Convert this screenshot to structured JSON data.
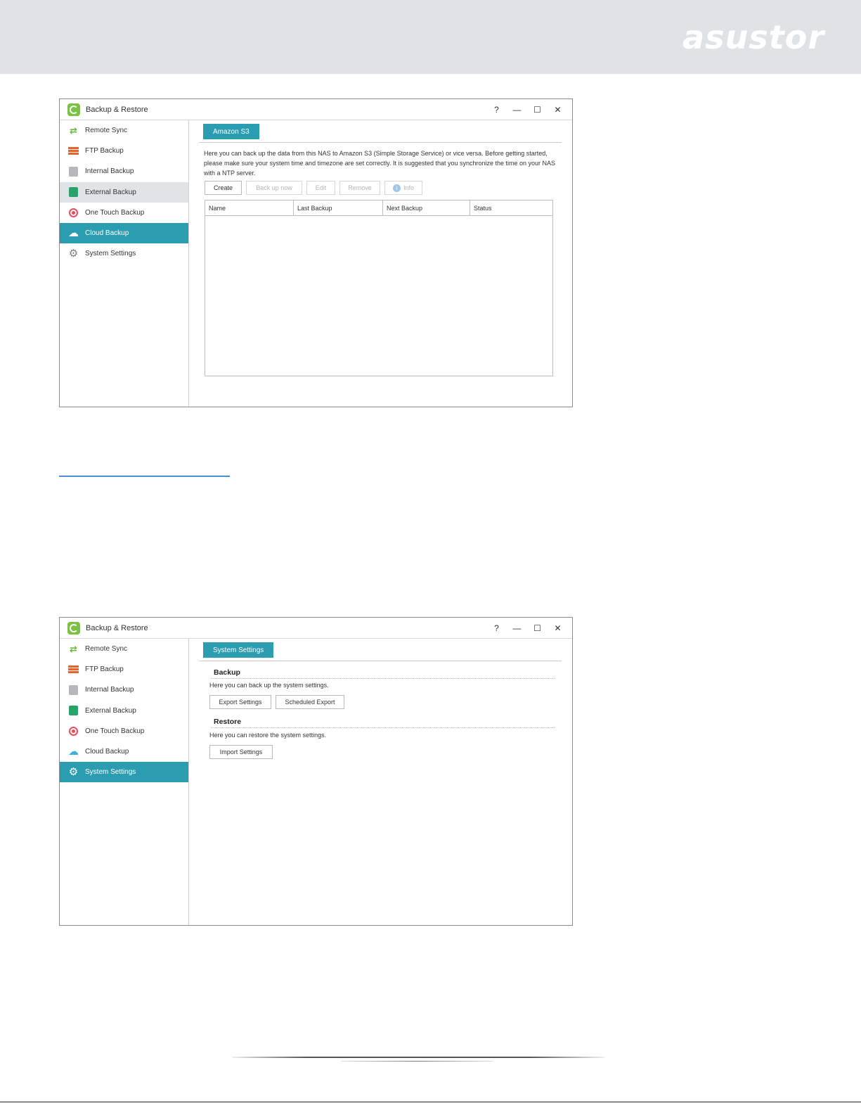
{
  "brand": {
    "logo_text": "asustor"
  },
  "window_top": {
    "title": "Backup & Restore",
    "controls": {
      "help": "?",
      "minimize": "—",
      "maximize": "☐",
      "close": "✕"
    },
    "sidebar": [
      {
        "label": "Remote Sync",
        "icon": "remote-sync-icon",
        "state": "normal"
      },
      {
        "label": "FTP Backup",
        "icon": "ftp-backup-icon",
        "state": "normal"
      },
      {
        "label": "Internal Backup",
        "icon": "internal-backup-icon",
        "state": "normal"
      },
      {
        "label": "External Backup",
        "icon": "external-backup-icon",
        "state": "hover"
      },
      {
        "label": "One Touch Backup",
        "icon": "one-touch-backup-icon",
        "state": "normal"
      },
      {
        "label": "Cloud Backup",
        "icon": "cloud-icon",
        "state": "active"
      },
      {
        "label": "System Settings",
        "icon": "gear-icon",
        "state": "normal"
      }
    ],
    "tab": "Amazon S3",
    "description": "Here you can back up the data from this NAS to Amazon S3 (Simple Storage Service) or vice versa. Before getting started, please make sure your system time and timezone are set correctly. It is suggested that you synchronize the time on your NAS with a NTP server.",
    "toolbar": {
      "create": "Create",
      "back_up_now": "Back up now",
      "edit": "Edit",
      "remove": "Remove",
      "info": "Info"
    },
    "table_columns": [
      "Name",
      "Last Backup",
      "Next Backup",
      "Status"
    ]
  },
  "window_bottom": {
    "title": "Backup & Restore",
    "controls": {
      "help": "?",
      "minimize": "—",
      "maximize": "☐",
      "close": "✕"
    },
    "sidebar": [
      {
        "label": "Remote Sync",
        "icon": "remote-sync-icon",
        "state": "normal"
      },
      {
        "label": "FTP Backup",
        "icon": "ftp-backup-icon",
        "state": "normal"
      },
      {
        "label": "Internal Backup",
        "icon": "internal-backup-icon",
        "state": "normal"
      },
      {
        "label": "External Backup",
        "icon": "external-backup-icon",
        "state": "normal"
      },
      {
        "label": "One Touch Backup",
        "icon": "one-touch-backup-icon",
        "state": "normal"
      },
      {
        "label": "Cloud Backup",
        "icon": "cloud-icon",
        "state": "normal"
      },
      {
        "label": "System Settings",
        "icon": "gear-icon",
        "state": "active"
      }
    ],
    "tab": "System Settings",
    "backup": {
      "title": "Backup",
      "description": "Here you can back up the system settings.",
      "export_button": "Export Settings",
      "scheduled_export_button": "Scheduled Export"
    },
    "restore": {
      "title": "Restore",
      "description": "Here you can restore the system settings.",
      "import_button": "Import Settings"
    }
  },
  "colors": {
    "accent": "#2a9db1",
    "banner": "#dfe3e6",
    "hover": "#e1e4e7"
  }
}
